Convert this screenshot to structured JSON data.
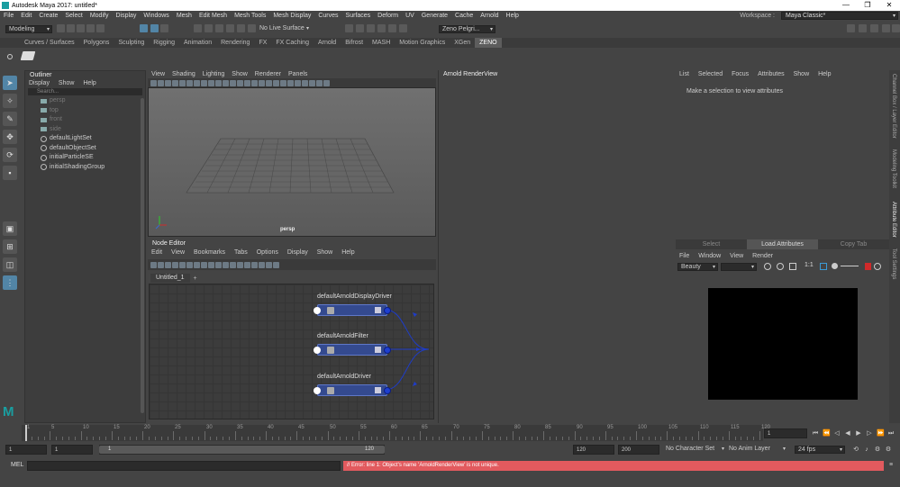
{
  "window": {
    "title": "Autodesk Maya 2017: untitled*",
    "min": "—",
    "max": "❐",
    "close": "✕"
  },
  "menubar": {
    "items": [
      "File",
      "Edit",
      "Create",
      "Select",
      "Modify",
      "Display",
      "Windows",
      "Mesh",
      "Edit Mesh",
      "Mesh Tools",
      "Mesh Display",
      "Curves",
      "Surfaces",
      "Deform",
      "UV",
      "Generate",
      "Cache",
      "Arnold",
      "Help"
    ],
    "workspace_label": "Workspace :",
    "workspace_value": "Maya Classic*"
  },
  "statusline": {
    "mode": "Modeling",
    "live_surface": "No Live Surface",
    "user": "Zeno Pelgri..."
  },
  "shelf": {
    "tabs": [
      "Curves / Surfaces",
      "Polygons",
      "Sculpting",
      "Rigging",
      "Animation",
      "Rendering",
      "FX",
      "FX Caching",
      "Arnold",
      "Bifrost",
      "MASH",
      "Motion Graphics",
      "XGen",
      "ZENO"
    ],
    "active": "ZENO"
  },
  "outliner": {
    "title": "Outliner",
    "menu": [
      "Display",
      "Show",
      "Help"
    ],
    "search_placeholder": "Search...",
    "items": [
      {
        "label": "persp",
        "kind": "cam",
        "dim": true
      },
      {
        "label": "top",
        "kind": "cam",
        "dim": true
      },
      {
        "label": "front",
        "kind": "cam",
        "dim": true
      },
      {
        "label": "side",
        "kind": "cam",
        "dim": true
      },
      {
        "label": "defaultLightSet",
        "kind": "set",
        "dim": false
      },
      {
        "label": "defaultObjectSet",
        "kind": "set",
        "dim": false
      },
      {
        "label": "initialParticleSE",
        "kind": "set",
        "dim": false
      },
      {
        "label": "initialShadingGroup",
        "kind": "set",
        "dim": false
      }
    ]
  },
  "viewport": {
    "menu": [
      "View",
      "Shading",
      "Lighting",
      "Show",
      "Renderer",
      "Panels"
    ],
    "camera_label": "persp"
  },
  "node_editor": {
    "title": "Node Editor",
    "menu": [
      "Edit",
      "View",
      "Bookmarks",
      "Tabs",
      "Options",
      "Display",
      "Show",
      "Help"
    ],
    "tab": "Untitled_1",
    "add_tab": "+",
    "nodes": [
      "defaultArnoldDisplayDriver",
      "defaultArnoldFilter",
      "defaultArnoldDriver"
    ]
  },
  "arnold_render_view": {
    "title": "Arnold RenderView"
  },
  "attribute_editor": {
    "menu": [
      "List",
      "Selected",
      "Focus",
      "Attributes",
      "Show",
      "Help"
    ],
    "message": "Make a selection to view attributes"
  },
  "render_view": {
    "tabs": [
      "Select",
      "Load Attributes",
      "Copy Tab"
    ],
    "active_tab": "Load Attributes",
    "menu": [
      "File",
      "Window",
      "View",
      "Render"
    ],
    "aov": "Beauty",
    "ratio": "1:1"
  },
  "side_tabs": [
    "Channel Box / Layer Editor",
    "Modeling Toolkit",
    "Attribute Editor",
    "Tool Settings"
  ],
  "side_tab_active": "Attribute Editor",
  "timeline": {
    "ticks": [
      "1",
      "5",
      "10",
      "15",
      "20",
      "25",
      "30",
      "35",
      "40",
      "45",
      "50",
      "55",
      "60",
      "65",
      "70",
      "75",
      "80",
      "85",
      "90",
      "95",
      "100",
      "105",
      "110",
      "115",
      "120"
    ],
    "current": "1"
  },
  "range": {
    "start": "1",
    "min": "1",
    "slider_start": "1",
    "slider_end": "120",
    "end": "120",
    "max": "200",
    "character_set": "No Character Set",
    "anim_layer": "No Anim Layer",
    "fps": "24 fps"
  },
  "command": {
    "label": "MEL",
    "error": "// Error: line 1: Object's name 'ArnoldRenderView' is not unique."
  }
}
